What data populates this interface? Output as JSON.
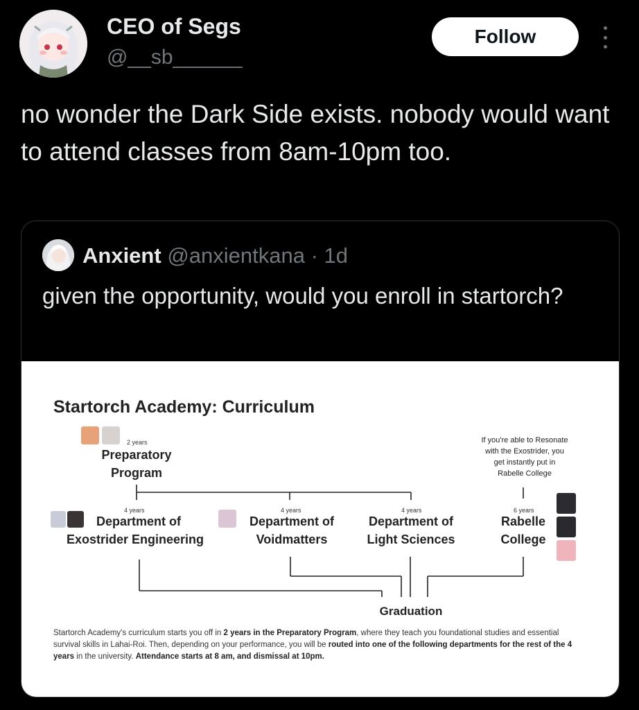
{
  "author": {
    "display_name": "CEO of Segs",
    "handle": "@__sb______"
  },
  "follow_label": "Follow",
  "tweet_text": "no wonder the Dark Side exists. nobody would want to attend classes from 8am-10pm too.",
  "quoted": {
    "display_name": "Anxient",
    "handle_time": "@anxientkana · 1d",
    "text": "given the opportunity, would you enroll in startorch?",
    "image": {
      "title": "Startorch Academy: Curriculum",
      "preparatory": {
        "years": "2 years",
        "label_line1": "Preparatory",
        "label_line2": "Program"
      },
      "resonate_note": {
        "line1": "If you're able to Resonate",
        "line2": "with the Exostrider, you",
        "line3": "get instantly put in",
        "line4": "Rabelle College"
      },
      "departments": [
        {
          "years": "4 years",
          "line1": "Department of",
          "line2": "Exostrider Engineering"
        },
        {
          "years": "4 years",
          "line1": "Department of",
          "line2": "Voidmatters"
        },
        {
          "years": "4 years",
          "line1": "Department of",
          "line2": "Light Sciences"
        },
        {
          "years": "6 years",
          "line1": "Rabelle",
          "line2": "College"
        }
      ],
      "graduation": "Graduation",
      "description": {
        "p1": "Startorch Academy's curriculum starts you off in ",
        "b1": "2 years in the Preparatory Program",
        "p2": ", where they teach you foundational studies and essential survival skills in Lahai-Roi. Then, depending on your performance, you will be ",
        "b2": "routed into one of the following departments for the rest of the 4 years",
        "p3": " in the university. ",
        "b3": "Attendance starts at 8 am, and dismissal at 10pm."
      }
    }
  },
  "colors": {
    "background": "#000000",
    "text_primary": "#e7e9ea",
    "text_secondary": "#71767b",
    "border": "#2f3336",
    "button_bg": "#ffffff"
  }
}
